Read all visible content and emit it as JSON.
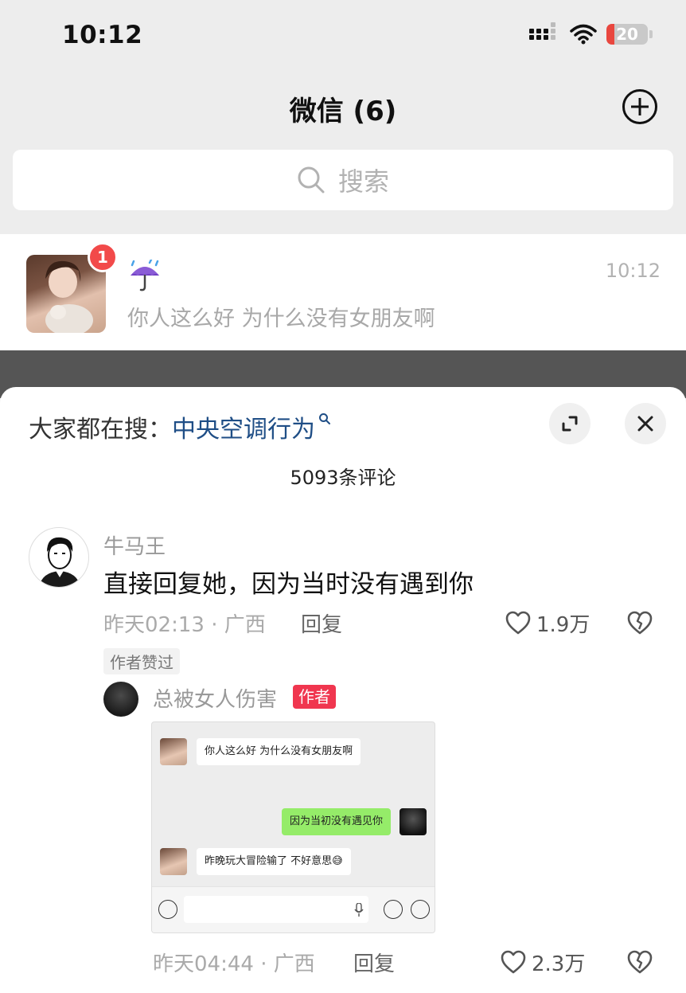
{
  "status_bar": {
    "time": "10:12",
    "battery": "20",
    "battery_level": 0.2
  },
  "header": {
    "title": "微信 (6)"
  },
  "search": {
    "placeholder": "搜索"
  },
  "chat": {
    "name_icon": "umbrella-with-rain-icon",
    "unread": "1",
    "time": "10:12",
    "preview": "你人这么好 为什么没有女朋友啊"
  },
  "comments_sheet": {
    "hot_search_prefix": "大家都在搜：",
    "hot_search_term": "中央空调行为",
    "comment_count": "5093条评论",
    "comment": {
      "username": "牛马王",
      "text": "直接回复她，因为当时没有遇到你",
      "time": "昨天02:13",
      "location": "广西",
      "reply_label": "回复",
      "likes": "1.9万",
      "author_liked": "作者赞过"
    },
    "reply": {
      "username": "总被女人伤害",
      "author_tag": "作者",
      "time": "昨天04:44",
      "location": "广西",
      "reply_label": "回复",
      "likes": "2.3万",
      "screenshot": {
        "msg1": "你人这么好 为什么没有女朋友啊",
        "msg2": "因为当初没有遇见你",
        "msg3": "昨晚玩大冒险输了 不好意思😅"
      }
    }
  },
  "colors": {
    "accent_red": "#f0364f",
    "wechat_green": "#95ec69",
    "link_blue": "#1f4e86"
  }
}
